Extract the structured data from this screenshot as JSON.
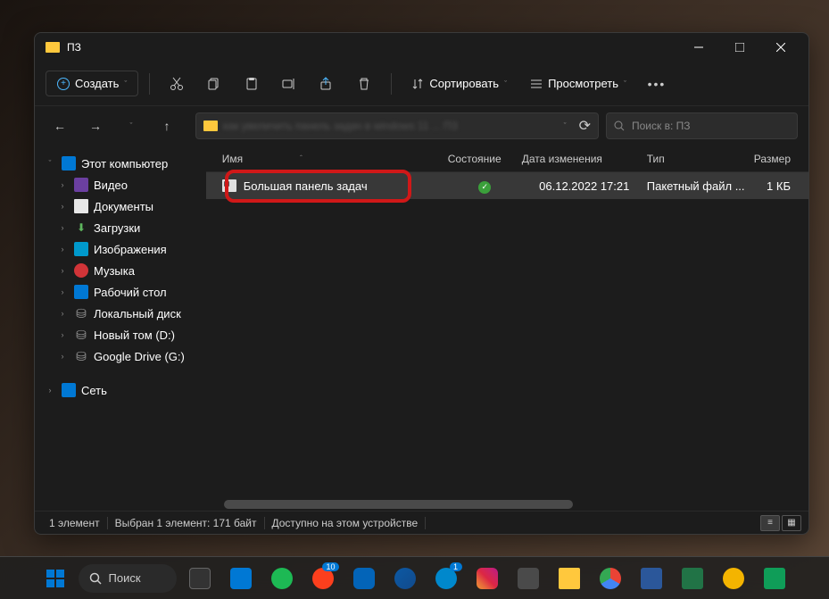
{
  "window": {
    "title": "ПЗ"
  },
  "toolbar": {
    "new_label": "Создать",
    "sort_label": "Сортировать",
    "view_label": "Просмотреть"
  },
  "navbar": {
    "address_blur": "как увеличить панель задач в windows 11 ... ПЗ",
    "search_placeholder": "Поиск в: ПЗ"
  },
  "sidebar": {
    "this_pc": "Этот компьютер",
    "items": [
      "Видео",
      "Документы",
      "Загрузки",
      "Изображения",
      "Музыка",
      "Рабочий стол",
      "Локальный диск",
      "Новый том (D:)",
      "Google Drive (G:)"
    ],
    "network": "Сеть"
  },
  "columns": {
    "name": "Имя",
    "state": "Состояние",
    "date": "Дата изменения",
    "type": "Тип",
    "size": "Размер"
  },
  "file": {
    "name": "Большая панель задач",
    "date": "06.12.2022 17:21",
    "type": "Пакетный файл ...",
    "size": "1 КБ"
  },
  "statusbar": {
    "count": "1 элемент",
    "selected": "Выбран 1 элемент: 171 байт",
    "avail": "Доступно на этом устройстве"
  },
  "taskbar": {
    "search": "Поиск",
    "badge1": "10",
    "badge2": "1"
  }
}
